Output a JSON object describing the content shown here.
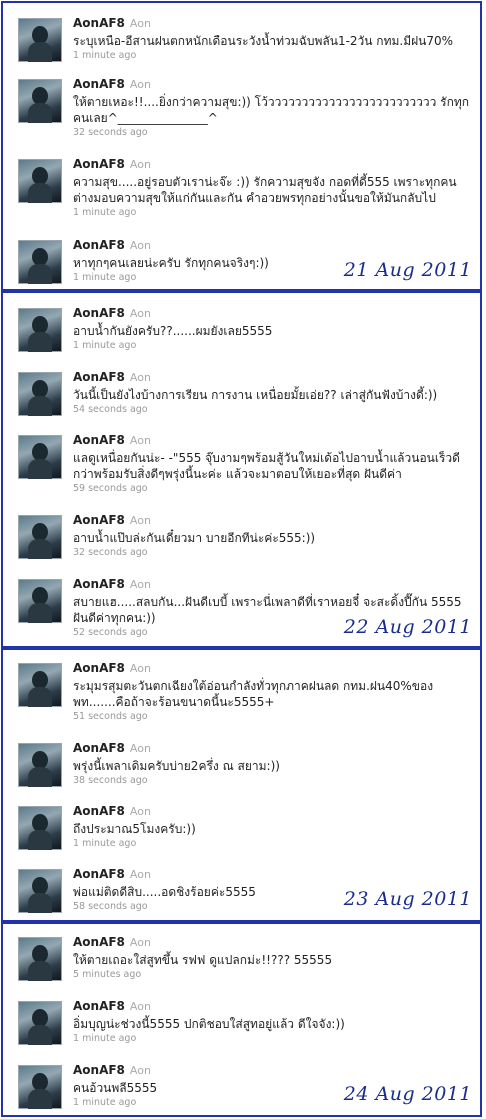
{
  "panels": [
    {
      "date": "21 Aug 2011",
      "tweets": [
        {
          "name": "AonAF8",
          "handle": "Aon",
          "text": "ระบุเหนือ-อีสานฝนตกหนักเดือนระวังน้ำท่วมฉับพลัน1-2วัน กทม.มีฝน70%",
          "time": "1 minute ago"
        },
        {
          "name": "AonAF8",
          "handle": "Aon",
          "text": "ให้ตายเหอะ!!....ยิ่งกว่าความสุข:)) โว้ววววววววววววววววววววววววว รักทุกคนเลย^_______________^",
          "time": "32 seconds ago"
        },
        {
          "name": "AonAF8",
          "handle": "Aon",
          "text": "ความสุข.....อยู่รอบตัวเราน่ะจ๊ะ :)) รักความสุขจัง กอดที่ดี้555 เพราะทุกคนต่างมอบความสุขให้แก่กันและกัน คำอวยพรทุกอย่างนั้นขอให้มันกลับไป",
          "time": "1 minute ago"
        },
        {
          "name": "AonAF8",
          "handle": "Aon",
          "text": "หาทุกๆคนเลยน่ะครับ รักทุกคนจริงๆ:))",
          "time": "1 minute ago"
        }
      ]
    },
    {
      "date": "22 Aug 2011",
      "tweets": [
        {
          "name": "AonAF8",
          "handle": "Aon",
          "text": "อาบน้ำกันยังครับ??......ผมยังเลย5555",
          "time": "1 minute ago"
        },
        {
          "name": "AonAF8",
          "handle": "Aon",
          "text": "วันนี้เป็นยังไงบ้างการเรียน การงาน เหนื่อยมั้ยเอ่ย?? เล่าสู่กันฟังบ้างดี้:))",
          "time": "54 seconds ago"
        },
        {
          "name": "AonAF8",
          "handle": "Aon",
          "text": "แลดูเหนื่อยกันน่ะ- -\"555 จุ๊บงามๆพร้อมสู้วันใหม่เด้อไปอาบน้ำแล้วนอนเร็วดีกว่าพร้อมรับสิ่งดีๆพรุ่งนี้นะค่ะ แล้วจะมาตอบให้เยอะที่สุด ฝันดีค่า",
          "time": "59 seconds ago"
        },
        {
          "name": "AonAF8",
          "handle": "Aon",
          "text": "อาบน้ำแป๊บล่ะกันเดี๋ยวมา บายอีกทีน่ะค่ะ555:))",
          "time": "32 seconds ago"
        },
        {
          "name": "AonAF8",
          "handle": "Aon",
          "text": "สบายแฮ.....สลบกัน...ฝันดีเบบี้ เพราะนี่เพลาดีที่เราหอยจี๋ จะสะดิ้งปี๊กัน 5555 ฝันดีค่าทุกคน:))",
          "time": "52 seconds ago"
        }
      ]
    },
    {
      "date": "23 Aug 2011",
      "tweets": [
        {
          "name": "AonAF8",
          "handle": "Aon",
          "text": "ระมุมรสุมตะวันตกเฉียงใต้อ่อนกำลังทั่วทุกภาคฝนลด กทม.ฝน40%ของพท.......คือถ้าจะร้อนขนาดนี้นะ5555+",
          "time": "51 seconds ago"
        },
        {
          "name": "AonAF8",
          "handle": "Aon",
          "text": "พรุ่งนี้เพลาเดิมครับบ่าย2ครึ่ง ณ สยาม:))",
          "time": "38 seconds ago"
        },
        {
          "name": "AonAF8",
          "handle": "Aon",
          "text": "ถึงประมาณ5โมงครับ:))",
          "time": "1 minute ago"
        },
        {
          "name": "AonAF8",
          "handle": "Aon",
          "text": "พ่อแม่ติดดีสิบ.....อดชิงร้อยค่ะ5555",
          "time": "58 seconds ago"
        }
      ]
    },
    {
      "date": "24 Aug 2011",
      "tweets": [
        {
          "name": "AonAF8",
          "handle": "Aon",
          "text": "ให้ตายเถอะใส่สูทขึ้น รฟฟ ดูแปลกม่ะ!!??? 55555",
          "time": "5 minutes ago"
        },
        {
          "name": "AonAF8",
          "handle": "Aon",
          "text": "อิ่มบุญน่ะช่วงนี้5555 ปกติชอบใส่สูทอยู่แล้ว ดีใจจัง:))",
          "time": "1 minute ago"
        },
        {
          "name": "AonAF8",
          "handle": "Aon",
          "text": "คนอ้วนพลี5555",
          "time": "1 minute ago"
        }
      ]
    }
  ],
  "colors": {
    "frame": "#2233aa",
    "stamp": "#1a2d8c",
    "name": "#222222",
    "meta": "#999999"
  }
}
